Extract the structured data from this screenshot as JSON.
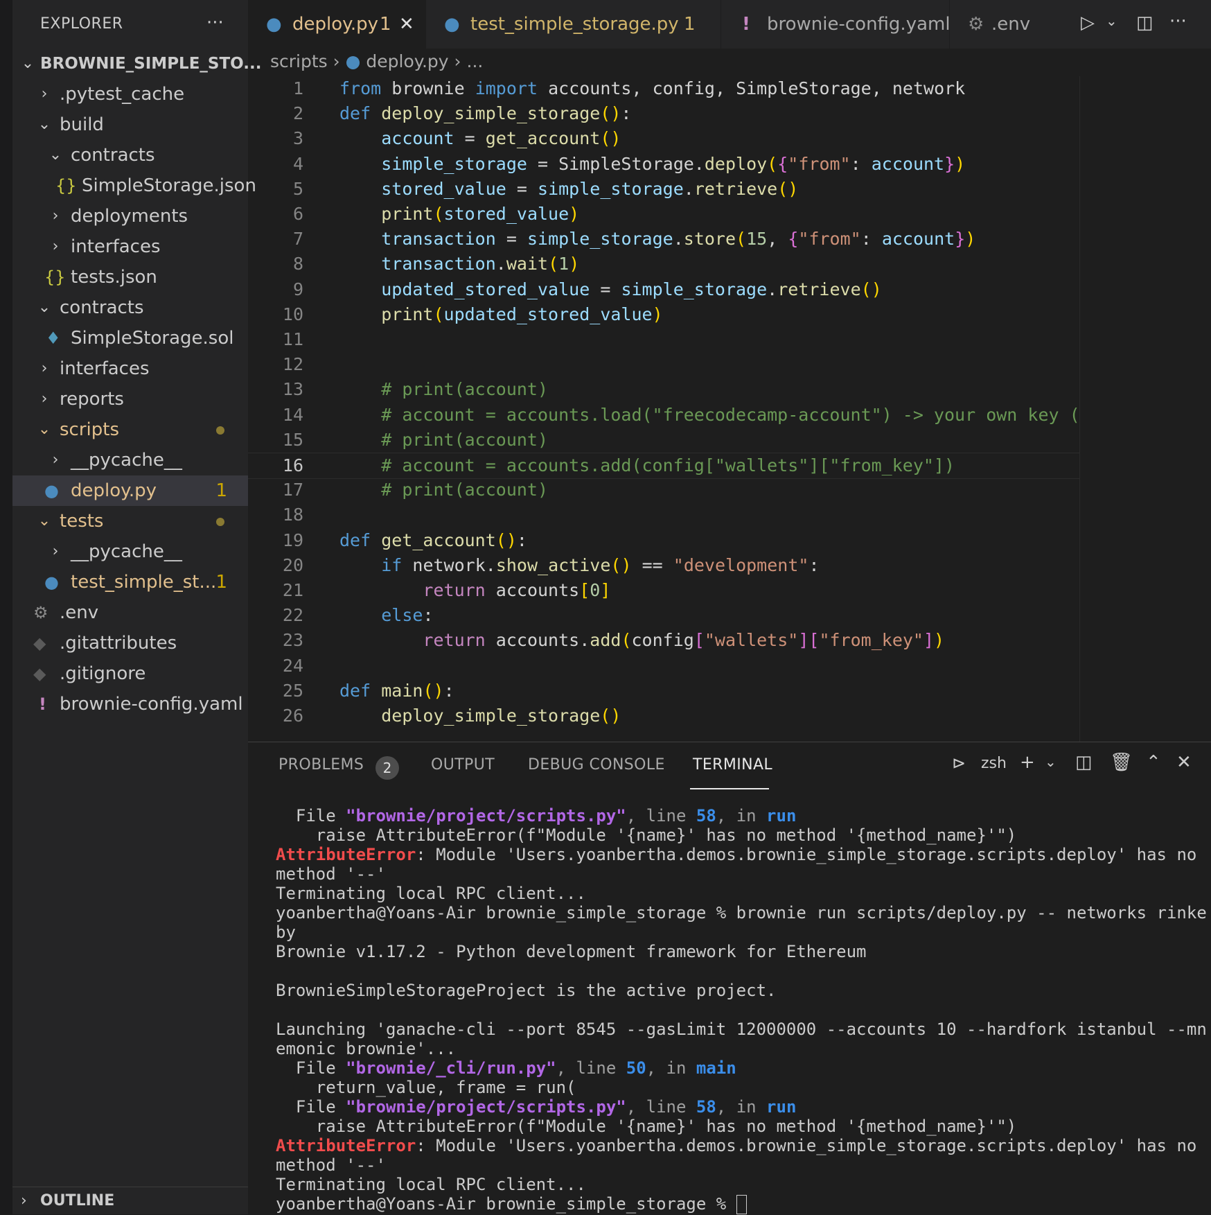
{
  "explorer": {
    "title": "EXPLORER",
    "project": "BROWNIE_SIMPLE_STO...",
    "items": [
      {
        "label": ".pytest_cache"
      },
      {
        "label": "build"
      },
      {
        "label": "contracts"
      },
      {
        "label": "SimpleStorage.json"
      },
      {
        "label": "deployments"
      },
      {
        "label": "interfaces"
      },
      {
        "label": "tests.json"
      },
      {
        "label": "contracts"
      },
      {
        "label": "SimpleStorage.sol"
      },
      {
        "label": "interfaces"
      },
      {
        "label": "reports"
      },
      {
        "label": "scripts"
      },
      {
        "label": "__pycache__"
      },
      {
        "label": "deploy.py",
        "badge": "1"
      },
      {
        "label": "tests"
      },
      {
        "label": "__pycache__"
      },
      {
        "label": "test_simple_st...",
        "badge": "1"
      },
      {
        "label": ".env"
      },
      {
        "label": ".gitattributes"
      },
      {
        "label": ".gitignore"
      },
      {
        "label": "brownie-config.yaml"
      }
    ],
    "outline": "OUTLINE"
  },
  "tabs": [
    {
      "label": "deploy.py",
      "badge": "1"
    },
    {
      "label": "test_simple_storage.py",
      "badge": "1"
    },
    {
      "label": "brownie-config.yaml"
    },
    {
      "label": ".env"
    }
  ],
  "breadcrumb": {
    "folder": "scripts",
    "file": "deploy.py",
    "more": "..."
  },
  "code": {
    "current_line": "16",
    "line_numbers": [
      "1",
      "2",
      "3",
      "4",
      "5",
      "6",
      "7",
      "8",
      "9",
      "10",
      "11",
      "12",
      "13",
      "14",
      "15",
      "16",
      "17",
      "18",
      "19",
      "20",
      "21",
      "22",
      "23",
      "24",
      "25",
      "26"
    ],
    "lines": [
      "from brownie import accounts, config, SimpleStorage, network",
      "def deploy_simple_storage():",
      "    account = get_account()",
      "    simple_storage = SimpleStorage.deploy({\"from\": account})",
      "    stored_value = simple_storage.retrieve()",
      "    print(stored_value)",
      "    transaction = simple_storage.store(15, {\"from\": account})",
      "    transaction.wait(1)",
      "    updated_stored_value = simple_storage.retrieve()",
      "    print(updated_stored_value)",
      "",
      "",
      "    # print(account)",
      "    # account = accounts.load(\"freecodecamp-account\") -> your own key (env",
      "    # print(account)",
      "    # account = accounts.add(config[\"wallets\"][\"from_key\"])",
      "    # print(account)",
      "",
      "def get_account():",
      "    if network.show_active() == \"development\":",
      "        return accounts[0]",
      "    else:",
      "        return accounts.add(config[\"wallets\"][\"from_key\"])",
      "",
      "def main():",
      "    deploy_simple_storage()"
    ]
  },
  "panel": {
    "tabs": [
      "PROBLEMS",
      "OUTPUT",
      "DEBUG CONSOLE",
      "TERMINAL"
    ],
    "problems_count": "2",
    "shell": "zsh",
    "terminal": [
      {
        "parts": [
          [
            "",
            "  File "
          ],
          [
            "t-file",
            "\"brownie/project/scripts.py\""
          ],
          [
            "t-dim",
            ", line "
          ],
          [
            "t-num",
            "58"
          ],
          [
            "t-dim",
            ", in "
          ],
          [
            "t-fn",
            "run"
          ]
        ]
      },
      {
        "parts": [
          [
            "",
            "    raise AttributeError(f\"Module '{name}' has no method '{method_name}'\")"
          ]
        ]
      },
      {
        "parts": [
          [
            "t-err",
            "AttributeError"
          ],
          [
            "",
            ": Module 'Users.yoanbertha.demos.brownie_simple_storage.scripts.deploy' has no"
          ]
        ]
      },
      {
        "parts": [
          [
            "",
            "method '--'"
          ]
        ]
      },
      {
        "parts": [
          [
            "",
            "Terminating local RPC client..."
          ]
        ]
      },
      {
        "parts": [
          [
            "",
            "yoanbertha@Yoans-Air brownie_simple_storage % brownie run scripts/deploy.py -- networks rinke"
          ]
        ]
      },
      {
        "parts": [
          [
            "",
            "by"
          ]
        ]
      },
      {
        "parts": [
          [
            "",
            "Brownie v1.17.2 - Python development framework for Ethereum"
          ]
        ]
      },
      {
        "parts": [
          [
            "",
            ""
          ]
        ]
      },
      {
        "parts": [
          [
            "",
            "BrownieSimpleStorageProject is the active project."
          ]
        ]
      },
      {
        "parts": [
          [
            "",
            ""
          ]
        ]
      },
      {
        "parts": [
          [
            "",
            "Launching 'ganache-cli --port 8545 --gasLimit 12000000 --accounts 10 --hardfork istanbul --mn"
          ]
        ]
      },
      {
        "parts": [
          [
            "",
            "emonic brownie'..."
          ]
        ]
      },
      {
        "parts": [
          [
            "",
            "  File "
          ],
          [
            "t-file",
            "\"brownie/_cli/run.py\""
          ],
          [
            "t-dim",
            ", line "
          ],
          [
            "t-num",
            "50"
          ],
          [
            "t-dim",
            ", in "
          ],
          [
            "t-fn",
            "main"
          ]
        ]
      },
      {
        "parts": [
          [
            "",
            "    return_value, frame = run("
          ]
        ]
      },
      {
        "parts": [
          [
            "",
            "  File "
          ],
          [
            "t-file",
            "\"brownie/project/scripts.py\""
          ],
          [
            "t-dim",
            ", line "
          ],
          [
            "t-num",
            "58"
          ],
          [
            "t-dim",
            ", in "
          ],
          [
            "t-fn",
            "run"
          ]
        ]
      },
      {
        "parts": [
          [
            "",
            "    raise AttributeError(f\"Module '{name}' has no method '{method_name}'\")"
          ]
        ]
      },
      {
        "parts": [
          [
            "t-err",
            "AttributeError"
          ],
          [
            "",
            ": Module 'Users.yoanbertha.demos.brownie_simple_storage.scripts.deploy' has no"
          ]
        ]
      },
      {
        "parts": [
          [
            "",
            "method '--'"
          ]
        ]
      },
      {
        "parts": [
          [
            "",
            "Terminating local RPC client..."
          ]
        ]
      },
      {
        "parts": [
          [
            "",
            "yoanbertha@Yoans-Air brownie_simple_storage % "
          ]
        ],
        "cursor": true
      }
    ]
  }
}
